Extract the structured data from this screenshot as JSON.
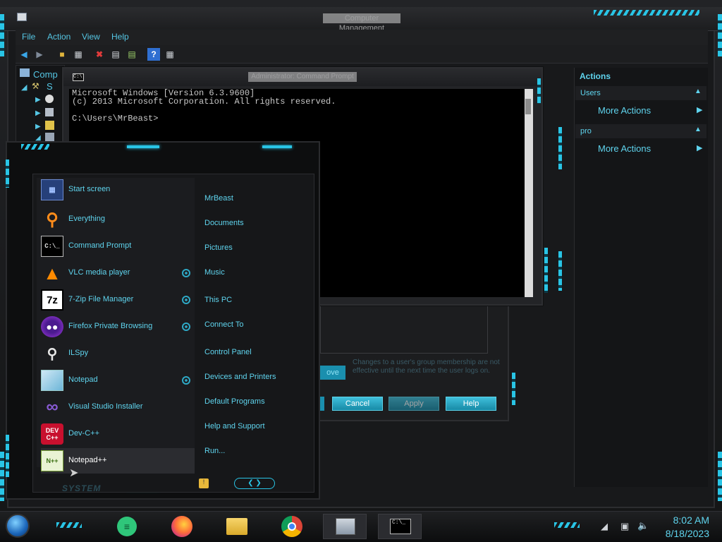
{
  "main_window": {
    "title": "Computer Management",
    "menu": [
      "File",
      "Action",
      "View",
      "Help"
    ],
    "toolbar_icons": [
      "back-arrow-icon",
      "forward-arrow-icon",
      "folder-up-icon",
      "console-tree-icon",
      "delete-icon",
      "properties-icon",
      "export-list-icon",
      "help-icon",
      "action-pane-icon"
    ]
  },
  "tree": {
    "root_label": "Comp",
    "child_label": "S"
  },
  "actions": {
    "header": "Actions",
    "sections": [
      {
        "title": "Users",
        "item": "More Actions"
      },
      {
        "title": "pro",
        "item": "More Actions"
      }
    ]
  },
  "cmd": {
    "title": "Administrator: Command Prompt",
    "lines": [
      "Microsoft Windows [Version 6.3.9600]",
      "(c) 2013 Microsoft Corporation. All rights reserved.",
      "",
      "C:\\Users\\MrBeast>"
    ]
  },
  "dialog": {
    "note": "Changes to a user's group membership are not effective until the next time the user logs on.",
    "remove_fragment": "ove",
    "buttons": {
      "cancel": "Cancel",
      "apply": "Apply",
      "help": "Help"
    }
  },
  "start_menu": {
    "programs": [
      {
        "label": "Start screen",
        "icon": "start-screen-icon",
        "arrow": false
      },
      {
        "label": "Everything",
        "icon": "magnifier-icon",
        "arrow": false
      },
      {
        "label": "Command Prompt",
        "icon": "cmd-icon",
        "arrow": false
      },
      {
        "label": "VLC media player",
        "icon": "vlc-cone-icon",
        "arrow": true
      },
      {
        "label": "7-Zip File Manager",
        "icon": "7zip-icon",
        "arrow": true
      },
      {
        "label": "Firefox Private Browsing",
        "icon": "firefox-private-icon",
        "arrow": true
      },
      {
        "label": "ILSpy",
        "icon": "ilspy-icon",
        "arrow": false
      },
      {
        "label": "Notepad",
        "icon": "notepad-icon",
        "arrow": true
      },
      {
        "label": "Visual Studio Installer",
        "icon": "vs-installer-icon",
        "arrow": false
      },
      {
        "label": "Dev-C++",
        "icon": "devcpp-icon",
        "arrow": false
      },
      {
        "label": "Notepad++",
        "icon": "notepadpp-icon",
        "arrow": false
      }
    ],
    "places": [
      "MrBeast",
      "Documents",
      "Pictures",
      "Music",
      "This PC",
      "Connect To",
      "Control Panel",
      "Devices and Printers",
      "Default Programs",
      "Help and Support",
      "Run..."
    ],
    "system_label": "SYSTEM",
    "accent_color": "#29c5e6"
  },
  "taskbar": {
    "time": "8:02 AM",
    "date": "8/18/2023",
    "apps": [
      "start-orb-icon",
      "green-notes-icon",
      "firefox-icon",
      "file-explorer-icon",
      "chrome-icon",
      "computer-management-icon",
      "cmd-taskbar-icon"
    ]
  }
}
